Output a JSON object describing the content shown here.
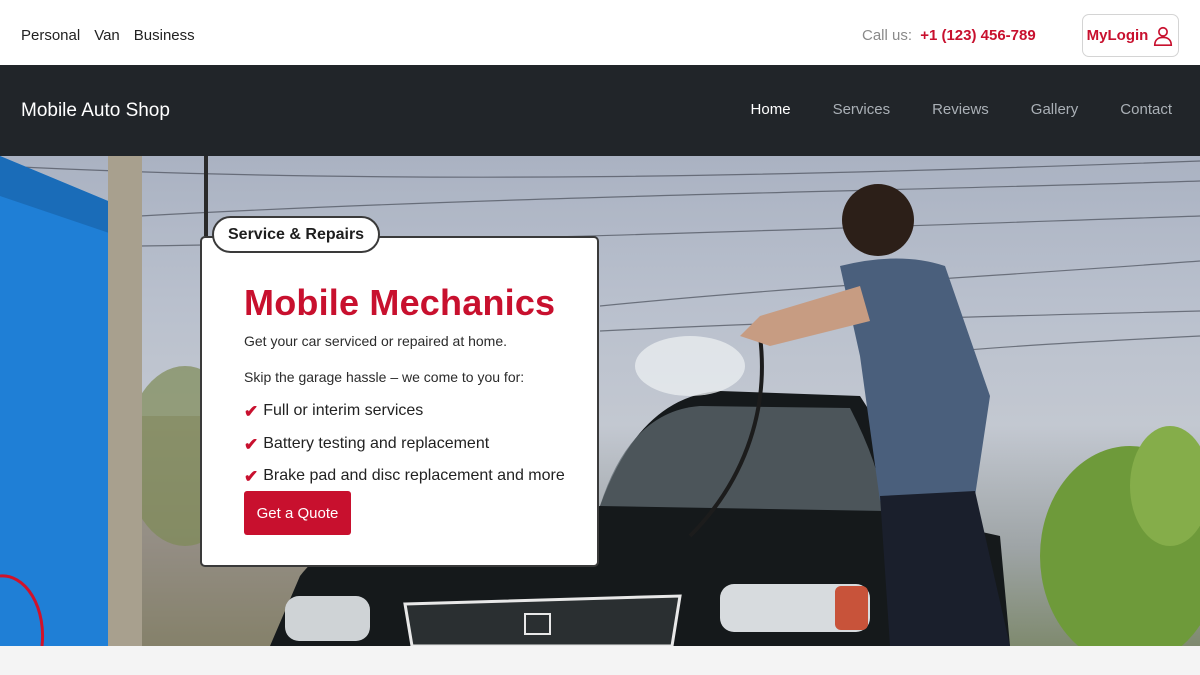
{
  "topbar": {
    "segments": [
      "Personal",
      "Van",
      "Business"
    ],
    "call_label": "Call us:",
    "phone": "+1 (123) 456-789",
    "login_label": "MyLogin",
    "login_icon": "user-icon"
  },
  "nav": {
    "brand": "Mobile Auto Shop",
    "items": [
      {
        "label": "Home",
        "active": true
      },
      {
        "label": "Services",
        "active": false
      },
      {
        "label": "Reviews",
        "active": false
      },
      {
        "label": "Gallery",
        "active": false
      },
      {
        "label": "Contact",
        "active": false
      }
    ]
  },
  "hero": {
    "badge": "Service & Repairs",
    "title": "Mobile Mechanics",
    "subtitle": "Get your car serviced or repaired at home.",
    "lead": "Skip the garage hassle – we come to you for:",
    "features": [
      "Full or interim services",
      "Battery testing and replacement",
      "Brake pad and disc replacement and more"
    ],
    "cta": "Get a Quote",
    "check_icon": "check-icon"
  },
  "colors": {
    "accent": "#c8102e",
    "nav_bg": "#212529",
    "nav_text": "#aab0b6",
    "nav_active": "#ffffff"
  }
}
